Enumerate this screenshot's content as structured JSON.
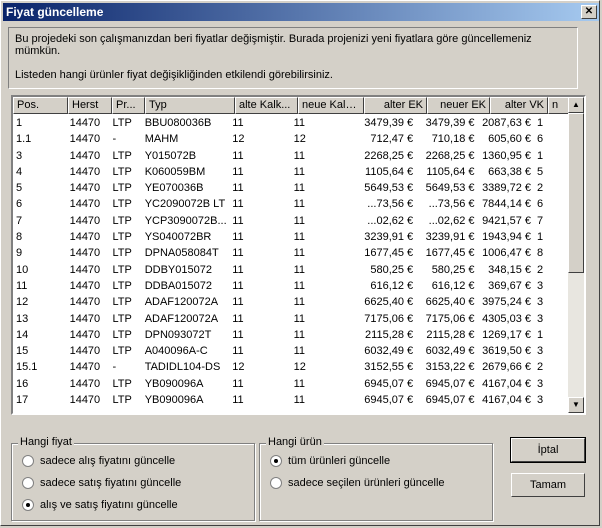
{
  "title": "Fiyat güncelleme",
  "info": {
    "line1": "Bu projedeki son çalışmanızdan beri fiyatlar değişmiştir. Burada projenizi yeni fiyatlara göre güncellemeniz mümkün.",
    "line2": "Listeden hangi ürünler fiyat değişikliğinden etkilendi görebilirsiniz."
  },
  "columns": [
    "Pos.",
    "Herst",
    "Pr...",
    "Typ",
    "alte Kalk...",
    "neue Kalk...",
    "alter EK",
    "neuer EK",
    "alter VK",
    "n"
  ],
  "rows": [
    [
      "1",
      "14470",
      "LTP",
      "BBU080036B",
      "11",
      "11",
      "3479,39 €",
      "3479,39 €",
      "2087,63 €",
      "1"
    ],
    [
      "1.1",
      "14470",
      "-",
      "MAHM",
      "12",
      "12",
      "712,47 €",
      "710,18 €",
      "605,60 €",
      "6"
    ],
    [
      "3",
      "14470",
      "LTP",
      "Y015072B",
      "11",
      "11",
      "2268,25 €",
      "2268,25 €",
      "1360,95 €",
      "1"
    ],
    [
      "4",
      "14470",
      "LTP",
      "K060059BM",
      "11",
      "11",
      "1105,64 €",
      "1105,64 €",
      "663,38 €",
      "5"
    ],
    [
      "5",
      "14470",
      "LTP",
      "YE070036B",
      "11",
      "11",
      "5649,53 €",
      "5649,53 €",
      "3389,72 €",
      "2"
    ],
    [
      "6",
      "14470",
      "LTP",
      "YC2090072B LT",
      "11",
      "11",
      "...73,56 €",
      "...73,56 €",
      "7844,14 €",
      "6"
    ],
    [
      "7",
      "14470",
      "LTP",
      "YCP3090072B...",
      "11",
      "11",
      "...02,62 €",
      "...02,62 €",
      "9421,57 €",
      "7"
    ],
    [
      "8",
      "14470",
      "LTP",
      "YS040072BR",
      "11",
      "11",
      "3239,91 €",
      "3239,91 €",
      "1943,94 €",
      "1"
    ],
    [
      "9",
      "14470",
      "LTP",
      "DPNA058084T",
      "11",
      "11",
      "1677,45 €",
      "1677,45 €",
      "1006,47 €",
      "8"
    ],
    [
      "10",
      "14470",
      "LTP",
      "DDBY015072",
      "11",
      "11",
      "580,25 €",
      "580,25 €",
      "348,15 €",
      "2"
    ],
    [
      "11",
      "14470",
      "LTP",
      "DDBA015072",
      "11",
      "11",
      "616,12 €",
      "616,12 €",
      "369,67 €",
      "3"
    ],
    [
      "12",
      "14470",
      "LTP",
      "ADAF120072A",
      "11",
      "11",
      "6625,40 €",
      "6625,40 €",
      "3975,24 €",
      "3"
    ],
    [
      "13",
      "14470",
      "LTP",
      "ADAF120072A",
      "11",
      "11",
      "7175,06 €",
      "7175,06 €",
      "4305,03 €",
      "3"
    ],
    [
      "14",
      "14470",
      "LTP",
      "DPN093072T",
      "11",
      "11",
      "2115,28 €",
      "2115,28 €",
      "1269,17 €",
      "1"
    ],
    [
      "15",
      "14470",
      "LTP",
      "A040096A-C",
      "11",
      "11",
      "6032,49 €",
      "6032,49 €",
      "3619,50 €",
      "3"
    ],
    [
      "15.1",
      "14470",
      "-",
      "TADIDL104-DS",
      "12",
      "12",
      "3152,55 €",
      "3153,22 €",
      "2679,66 €",
      "2"
    ],
    [
      "16",
      "14470",
      "LTP",
      "YB090096A",
      "11",
      "11",
      "6945,07 €",
      "6945,07 €",
      "4167,04 €",
      "3"
    ],
    [
      "17",
      "14470",
      "LTP",
      "YB090096A",
      "11",
      "11",
      "6945,07 €",
      "6945,07 €",
      "4167,04 €",
      "3"
    ]
  ],
  "group_price": {
    "label": "Hangi fiyat",
    "options": [
      "sadece alış fiyatını güncelle",
      "sadece satış fiyatını güncelle",
      "alış ve satış  fiyatını güncelle"
    ],
    "selected": 2
  },
  "group_product": {
    "label": "Hangi ürün",
    "options": [
      "tüm ürünleri güncelle",
      "sadece seçilen ürünleri güncelle"
    ],
    "selected": 0
  },
  "buttons": {
    "cancel": "İptal",
    "ok": "Tamam"
  }
}
